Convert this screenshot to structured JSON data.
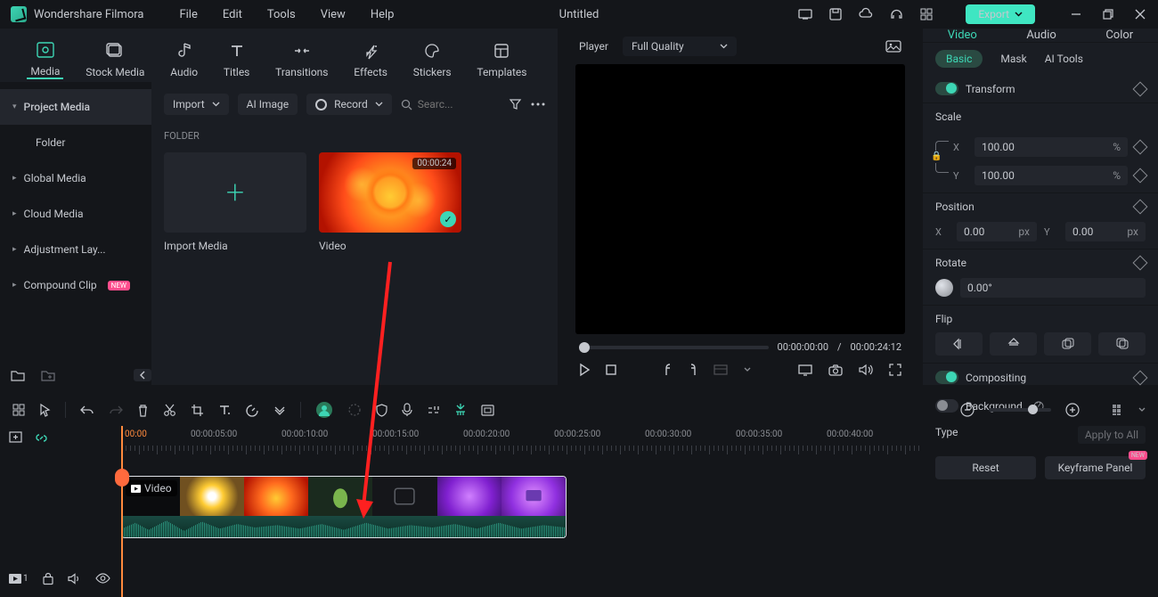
{
  "app": {
    "title": "Wondershare Filmora",
    "doc": "Untitled"
  },
  "menu": [
    "File",
    "Edit",
    "Tools",
    "View",
    "Help"
  ],
  "export": "Export",
  "top_tabs": [
    {
      "label": "Media",
      "icon": "media"
    },
    {
      "label": "Stock Media",
      "icon": "stock"
    },
    {
      "label": "Audio",
      "icon": "audio"
    },
    {
      "label": "Titles",
      "icon": "titles"
    },
    {
      "label": "Transitions",
      "icon": "trans"
    },
    {
      "label": "Effects",
      "icon": "fx"
    },
    {
      "label": "Stickers",
      "icon": "stick"
    },
    {
      "label": "Templates",
      "icon": "tmpl"
    }
  ],
  "sidebar": {
    "header": "Project Media",
    "sub": "Folder",
    "items": [
      "Global Media",
      "Cloud Media",
      "Adjustment Lay...",
      "Compound Clip"
    ],
    "new": "NEW"
  },
  "content": {
    "import": "Import",
    "ai_image": "AI Image",
    "record": "Record",
    "search_ph": "Searc...",
    "folder": "FOLDER",
    "cards": [
      {
        "label": "Import Media"
      },
      {
        "label": "Video",
        "duration": "00:00:24"
      }
    ]
  },
  "preview": {
    "player": "Player",
    "quality": "Full Quality",
    "t1": "00:00:00:00",
    "sep": "/",
    "t2": "00:00:24:12"
  },
  "props": {
    "tabs": [
      "Video",
      "Audio",
      "Color"
    ],
    "subtabs": [
      "Basic",
      "Mask",
      "AI Tools"
    ],
    "transform": "Transform",
    "scale": "Scale",
    "scale_x": "100.00",
    "scale_y": "100.00",
    "pct": "%",
    "position": "Position",
    "pos_x": "0.00",
    "pos_y": "0.00",
    "px": "px",
    "X": "X",
    "Y": "Y",
    "rotate": "Rotate",
    "rot_val": "0.00°",
    "flip": "Flip",
    "compositing": "Compositing",
    "background": "Background",
    "type": "Type",
    "apply": "Apply to All",
    "reset": "Reset",
    "keyframe": "Keyframe Panel",
    "new": "NEW"
  },
  "timeline": {
    "ticks": [
      "00:00",
      "00:00:05:00",
      "00:00:10:00",
      "00:00:15:00",
      "00:00:20:00",
      "00:00:25:00",
      "00:00:30:00",
      "00:00:35:00",
      "00:00:40:00"
    ],
    "clip": "Video",
    "track_num": "1"
  }
}
